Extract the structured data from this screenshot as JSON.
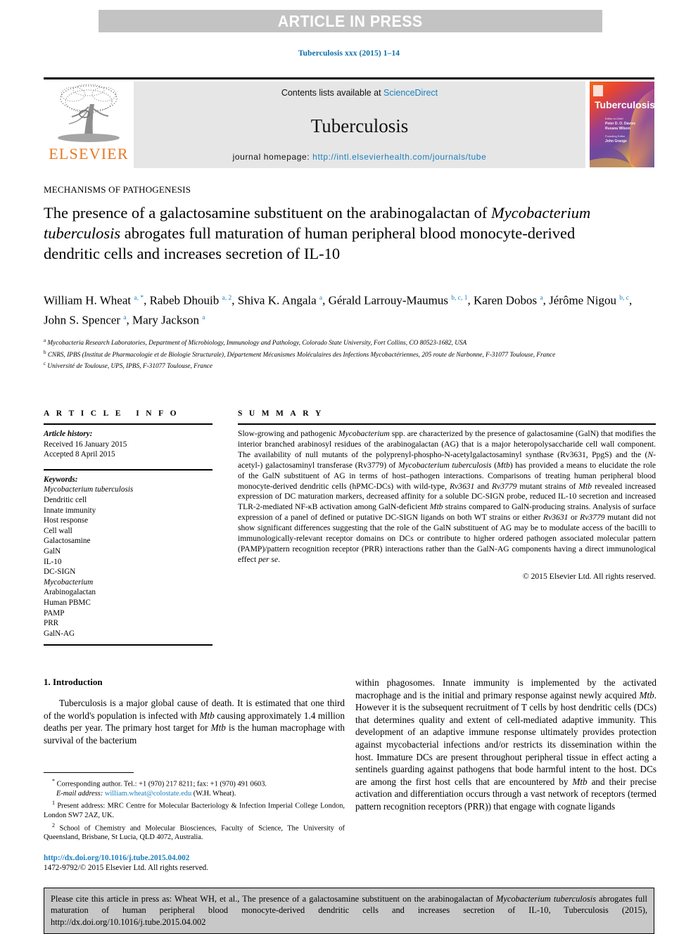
{
  "banner": {
    "text": "ARTICLE IN PRESS"
  },
  "running_head": "Tuberculosis xxx (2015) 1–14",
  "masthead": {
    "contents_prefix": "Contents lists available at ",
    "contents_link": "ScienceDirect",
    "journal_name": "Tuberculosis",
    "homepage_label": "journal homepage: ",
    "homepage_url": "http://intl.elsevierhealth.com/journals/tube",
    "publisher": "ELSEVIER",
    "cover_title": "Tuberculosis",
    "cover_sub1": "Editor-in-Chief",
    "cover_sub2": "Peter D. O. Davies",
    "cover_sub3": "Ruxana Wilson",
    "cover_sub4": "Founding Editor",
    "cover_sub5": "John Grange"
  },
  "section_tag": "MECHANISMS OF PATHOGENESIS",
  "title": {
    "part1": "The presence of a galactosamine substituent on the arabinogalactan of ",
    "italic1": "Mycobacterium tuberculosis",
    "part2": " abrogates full maturation of human peripheral blood monocyte-derived dendritic cells and increases secretion of IL-10"
  },
  "authors": {
    "list": [
      {
        "name": "William H. Wheat",
        "marks": "a, *",
        "sep": ", "
      },
      {
        "name": "Rabeb Dhouib",
        "marks": "a, 2",
        "sep": ", "
      },
      {
        "name": "Shiva K. Angala",
        "marks": "a",
        "sep": ", "
      },
      {
        "name": "Gérald Larrouy-Maumus",
        "marks": "b, c, 1",
        "sep": ", "
      },
      {
        "name": "Karen Dobos",
        "marks": "a",
        "sep": ", "
      },
      {
        "name": "Jérôme Nigou",
        "marks": "b, c",
        "sep": ", "
      },
      {
        "name": "John S. Spencer",
        "marks": "a",
        "sep": ", "
      },
      {
        "name": "Mary Jackson",
        "marks": "a",
        "sep": ""
      }
    ]
  },
  "affiliations": [
    {
      "mark": "a",
      "text": "Mycobacteria Research Laboratories, Department of Microbiology, Immunology and Pathology, Colorado State University, Fort Collins, CO 80523-1682, USA"
    },
    {
      "mark": "b",
      "text": "CNRS, IPBS (Institut de Pharmacologie et de Biologie Structurale), Département Mécanismes Moléculaires des Infections Mycobactériennes, 205 route de Narbonne, F-31077 Toulouse, France"
    },
    {
      "mark": "c",
      "text": "Université de Toulouse, UPS, IPBS, F-31077 Toulouse, France"
    }
  ],
  "article_info": {
    "heading": "ARTICLE INFO",
    "history_label": "Article history:",
    "received": "Received 16 January 2015",
    "accepted": "Accepted 8 April 2015",
    "keywords_label": "Keywords:",
    "keywords": [
      "Mycobacterium tuberculosis",
      "Dendritic cell",
      "Innate immunity",
      "Host response",
      "Cell wall",
      "Galactosamine",
      "GalN",
      "IL-10",
      "DC-SIGN",
      "Mycobacterium",
      "Arabinogalactan",
      "Human PBMC",
      "PAMP",
      "PRR",
      "GalN-AG"
    ],
    "italic_keywords": [
      "Mycobacterium tuberculosis",
      "Mycobacterium"
    ]
  },
  "summary": {
    "heading": "SUMMARY",
    "body_html": "Slow-growing and pathogenic <i>Mycobacterium</i> spp. are characterized by the presence of galactosamine (GalN) that modifies the interior branched arabinosyl residues of the arabinogalactan (AG) that is a major heteropolysaccharide cell wall component. The availability of null mutants of the polyprenyl-phospho-N-acetylgalactosaminyl synthase (Rv3631, PpgS) and the (<i>N</i>-acetyl-) galactosaminyl transferase (Rv3779) of <i>Mycobacterium tuberculosis</i> (<i>Mtb</i>) has provided a means to elucidate the role of the GalN substituent of AG in terms of host–pathogen interactions. Comparisons of treating human peripheral blood monocyte-derived dendritic cells (hPMC-DCs) with wild-type, <i>Rv3631</i> and <i>Rv3779</i> mutant strains of <i>Mtb</i> revealed increased expression of DC maturation markers, decreased affinity for a soluble DC-SIGN probe, reduced IL-10 secretion and increased TLR-2-mediated NF-κB activation among GalN-deficient <i>Mtb</i> strains compared to GalN-producing strains. Analysis of surface expression of a panel of defined or putative DC-SIGN ligands on both WT strains or either <i>Rv3631</i> or <i>Rv3779</i> mutant did not show significant differences suggesting that the role of the GalN substituent of AG may be to modulate access of the bacilli to immunologically-relevant receptor domains on DCs or contribute to higher ordered pathogen associated molecular pattern (PAMP)/pattern recognition receptor (PRR) interactions rather than the GalN-AG components having a direct immunological effect <i>per se</i>.",
    "copyright": "© 2015 Elsevier Ltd. All rights reserved."
  },
  "introduction": {
    "heading": "1. Introduction",
    "left_para_html": "Tuberculosis is a major global cause of death. It is estimated that one third of the world's population is infected with <i>Mtb</i> causing approximately 1.4 million deaths per year. The primary host target for <i>Mtb</i> is the human macrophage with survival of the bacterium",
    "right_para_html": "within phagosomes. Innate immunity is implemented by the activated macrophage and is the initial and primary response against newly acquired <i>Mtb</i>. However it is the subsequent recruitment of T cells by host dendritic cells (DCs) that determines quality and extent of cell-mediated adaptive immunity. This development of an adaptive immune response ultimately provides protection against mycobacterial infections and/or restricts its dissemination within the host. Immature DCs are present throughout peripheral tissue in effect acting a sentinels guarding against pathogens that bode harmful intent to the host. DCs are among the first host cells that are encountered by <i>Mtb</i> and their precise activation and differentiation occurs through a vast network of receptors (termed pattern recognition receptors (PRR)) that engage with cognate ligands"
  },
  "footnotes": {
    "corresponding_html": "<sup>*</sup> Corresponding author. Tel.: +1 (970) 217 8211; fax: +1 (970) 491 0603.",
    "email_label": "E-mail address:",
    "email": "william.wheat@colostate.edu",
    "email_owner": "(W.H. Wheat).",
    "note1_html": "<sup>1</sup> Present address: MRC Centre for Molecular Bacteriology &amp; Infection Imperial College London, London SW7 2AZ, UK.",
    "note2_html": "<sup>2</sup> School of Chemistry and Molecular Biosciences, Faculty of Science, The University of Queensland, Brisbane, St Lucia, QLD 4072, Australia."
  },
  "doi_block": {
    "doi_url": "http://dx.doi.org/10.1016/j.tube.2015.04.002",
    "issn_line": "1472-9792/© 2015 Elsevier Ltd. All rights reserved."
  },
  "citation_box": {
    "html": "Please cite this article in press as: Wheat WH, et al., The presence of a galactosamine substituent on the arabinogalactan of <i>Mycobacterium tuberculosis</i> abrogates full maturation of human peripheral blood monocyte-derived dendritic cells and increases secretion of IL-10, Tuberculosis (2015), http://dx.doi.org/10.1016/j.tube.2015.04.002"
  },
  "colors": {
    "link": "#1a7fbf",
    "banner_bg": "#c3c3c3",
    "masthead_bg": "#e6e6e6",
    "elsevier_orange": "#e87722",
    "citation_bg": "#c8c8c8"
  }
}
